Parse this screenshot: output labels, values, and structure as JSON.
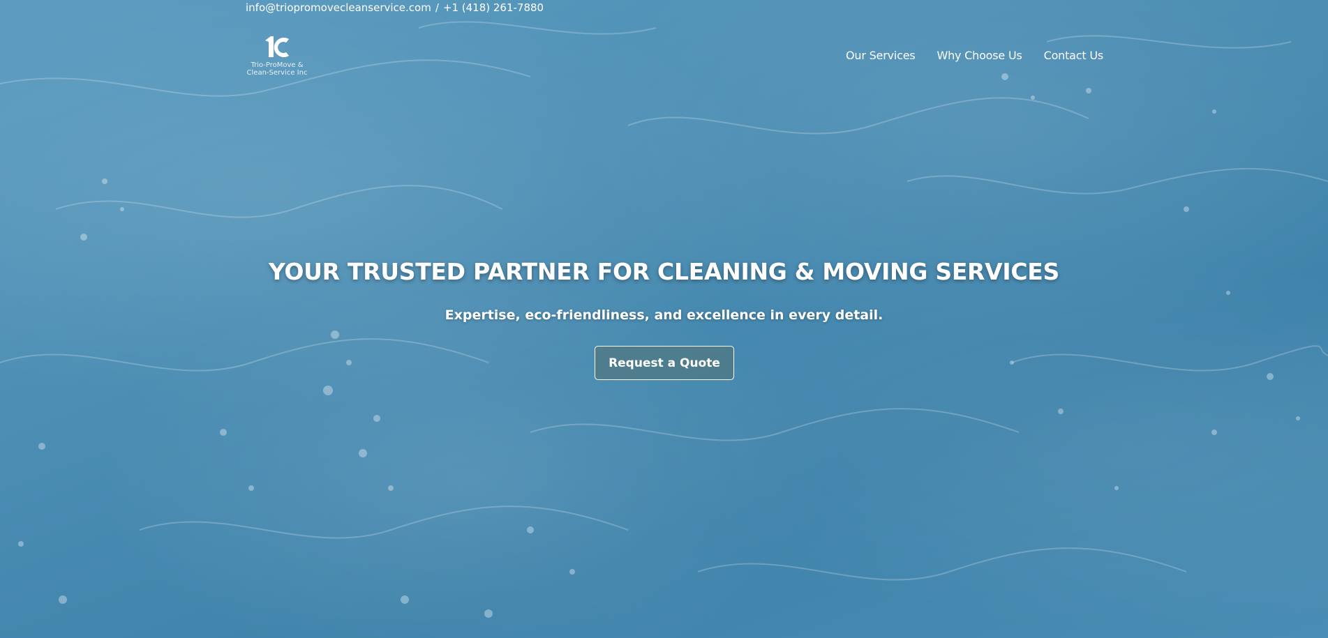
{
  "topbar": {
    "email": "info@triopromovecleanservice.com",
    "separator": "/",
    "phone": "+1 (418) 261-7880"
  },
  "logo": {
    "mark_icon": "tc-monogram-icon",
    "line1": "Trio-ProMove &",
    "line2": "Clean-Service Inc"
  },
  "nav": {
    "items": [
      {
        "label": "Our Services"
      },
      {
        "label": "Why Choose Us"
      },
      {
        "label": "Contact Us"
      }
    ]
  },
  "hero": {
    "title": "YOUR TRUSTED PARTNER FOR CLEANING & MOVING SERVICES",
    "subtitle": "Expertise, eco-friendliness, and excellence in every detail.",
    "cta_label": "Request a Quote",
    "background": "water-surface-image"
  },
  "colors": {
    "water_light": "#5b9cc0",
    "water_dark": "#3f83ab",
    "text": "#ffffff",
    "button_bg": "#50787f"
  }
}
